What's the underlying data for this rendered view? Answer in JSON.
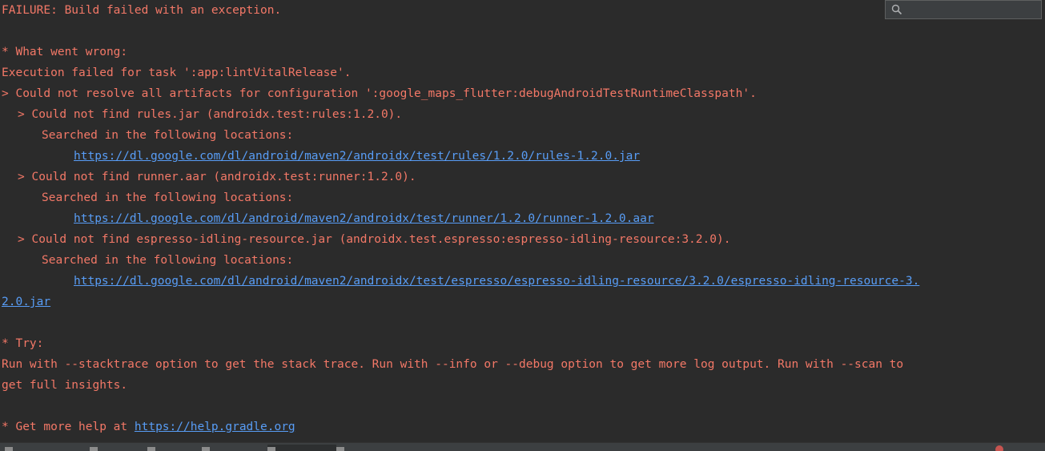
{
  "console": {
    "lines": [
      {
        "text": "FAILURE: Build failed with an exception."
      },
      {
        "text": ""
      },
      {
        "text": "* What went wrong:"
      },
      {
        "text": "Execution failed for task ':app:lintVitalRelease'."
      },
      {
        "text": "> Could not resolve all artifacts for configuration ':google_maps_flutter:debugAndroidTestRuntimeClasspath'."
      },
      {
        "text": "> Could not find rules.jar (androidx.test:rules:1.2.0)."
      },
      {
        "text": "Searched in the following locations:"
      },
      {
        "link": "https://dl.google.com/dl/android/maven2/androidx/test/rules/1.2.0/rules-1.2.0.jar"
      },
      {
        "text": "> Could not find runner.aar (androidx.test:runner:1.2.0)."
      },
      {
        "text": "Searched in the following locations:"
      },
      {
        "link": "https://dl.google.com/dl/android/maven2/androidx/test/runner/1.2.0/runner-1.2.0.aar"
      },
      {
        "text": "> Could not find espresso-idling-resource.jar (androidx.test.espresso:espresso-idling-resource:3.2.0)."
      },
      {
        "text": "Searched in the following locations:"
      },
      {
        "link": "https://dl.google.com/dl/android/maven2/androidx/test/espresso/espresso-idling-resource/3.2.0/espresso-idling-resource-3."
      },
      {
        "link": "2.0.jar"
      },
      {
        "text": ""
      },
      {
        "text": "* Try:"
      },
      {
        "text": "Run with --stacktrace option to get the stack trace. Run with --info or --debug option to get more log output. Run with --scan to"
      },
      {
        "text": "get full insights."
      },
      {
        "text": ""
      },
      {
        "text_prefix": "* Get more help at ",
        "link": "https://help.gradle.org"
      }
    ]
  },
  "search": {
    "value": "",
    "icon": "search-icon"
  },
  "colors": {
    "background": "#2b2b2b",
    "error_text": "#f37867",
    "link": "#589df6"
  }
}
